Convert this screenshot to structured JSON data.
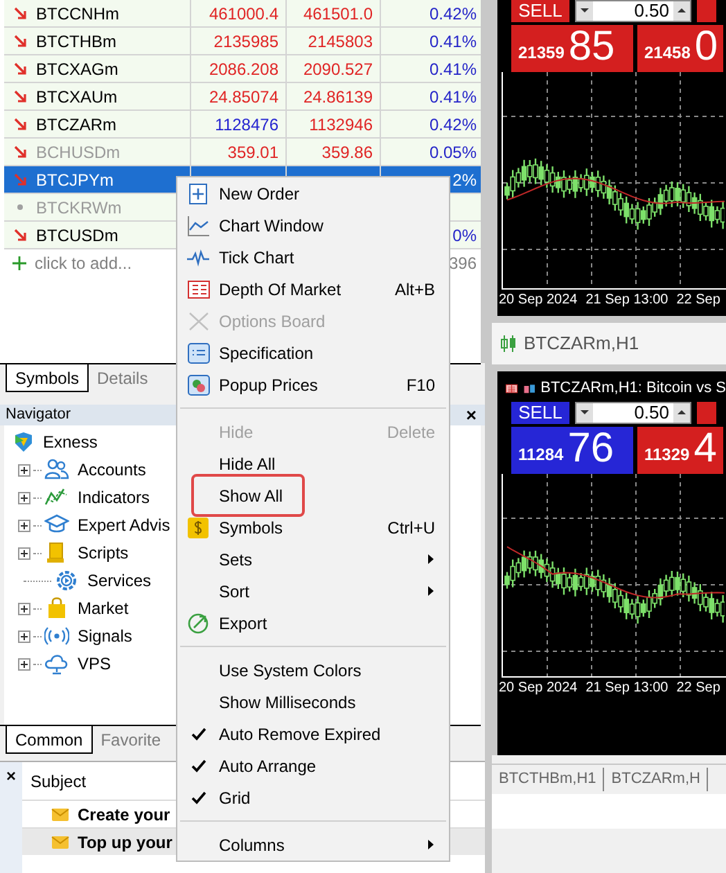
{
  "market_watch": {
    "rows": [
      {
        "symbol": "BTCCNHm",
        "kind": "down",
        "dimmed": false,
        "selected": false,
        "bid": "461000.4",
        "ask": "461501.0",
        "change": "0.42%",
        "bid_rising": false,
        "ask_rising": false
      },
      {
        "symbol": "BTCTHBm",
        "kind": "down",
        "dimmed": false,
        "selected": false,
        "bid": "2135985",
        "ask": "2145803",
        "change": "0.41%",
        "bid_rising": false,
        "ask_rising": false
      },
      {
        "symbol": "BTCXAGm",
        "kind": "down",
        "dimmed": false,
        "selected": false,
        "bid": "2086.208",
        "ask": "2090.527",
        "change": "0.41%",
        "bid_rising": false,
        "ask_rising": false
      },
      {
        "symbol": "BTCXAUm",
        "kind": "down",
        "dimmed": false,
        "selected": false,
        "bid": "24.85074",
        "ask": "24.86139",
        "change": "0.41%",
        "bid_rising": false,
        "ask_rising": false
      },
      {
        "symbol": "BTCZARm",
        "kind": "down",
        "dimmed": false,
        "selected": false,
        "bid": "1128476",
        "ask": "1132946",
        "change": "0.42%",
        "bid_rising": true,
        "ask_rising": false
      },
      {
        "symbol": "BCHUSDm",
        "kind": "down",
        "dimmed": true,
        "selected": false,
        "bid": "359.01",
        "ask": "359.86",
        "change": "0.05%",
        "bid_rising": false,
        "ask_rising": false
      },
      {
        "symbol": "BTCJPYm",
        "kind": "down",
        "dimmed": false,
        "selected": true,
        "change": "2%"
      },
      {
        "symbol": "BTCKRWm",
        "kind": "dot",
        "dimmed": true,
        "selected": false
      },
      {
        "symbol": "BTCUSDm",
        "kind": "down",
        "dimmed": false,
        "selected": false,
        "change": "0%"
      }
    ],
    "add_row": {
      "label": "click to add...",
      "value": "396"
    },
    "tabs": [
      {
        "label": "Symbols",
        "selected": true
      },
      {
        "label": "Details",
        "selected": false
      }
    ]
  },
  "navigator": {
    "title": "Navigator",
    "close": "×",
    "root": "Exness",
    "children": [
      {
        "label": "Accounts",
        "expanded": false
      },
      {
        "label": "Indicators",
        "expanded": false
      },
      {
        "label": "Expert Advis",
        "expanded": false
      },
      {
        "label": "Scripts",
        "expanded": false
      },
      {
        "label": "Services"
      },
      {
        "label": "Market",
        "expanded": false
      },
      {
        "label": "Signals",
        "expanded": false
      },
      {
        "label": "VPS",
        "expanded": false
      }
    ],
    "tabs": [
      {
        "label": "Common",
        "selected": true
      },
      {
        "label": "Favorite",
        "selected": false
      }
    ]
  },
  "toolbox": {
    "close": "×",
    "column": "Subject",
    "rows": [
      {
        "subject": "Create your",
        "selected": false
      },
      {
        "subject": "Top up your",
        "selected": true
      }
    ]
  },
  "charts": [
    {
      "sell": "SELL",
      "lot": "0.50",
      "bid_small": "21359",
      "bid_big": "85",
      "ask_small": "21458",
      "ask_big": "0",
      "bid_rising": false,
      "ask_rising": false,
      "xlabels": [
        "20 Sep 2024",
        "21 Sep 13:00",
        "22 Sep"
      ]
    },
    {
      "tab_label": "BTCZARm,H1",
      "title": "BTCZARm,H1: Bitcoin vs S",
      "sell": "SELL",
      "lot": "0.50",
      "bid_small": "11284",
      "bid_big": "76",
      "ask_small": "11329",
      "ask_big": "4",
      "bid_rising": true,
      "ask_rising": false,
      "xlabels": [
        "20 Sep 2024",
        "21 Sep 13:00",
        "22 Sep"
      ]
    }
  ],
  "chart_tabs": [
    {
      "label": "BTCTHBm,H1",
      "selected": false
    },
    {
      "label": "BTCZARm,H",
      "selected": false
    }
  ],
  "context_menu": [
    {
      "kind": "item",
      "label": "New Order"
    },
    {
      "kind": "item",
      "label": "Chart Window"
    },
    {
      "kind": "item",
      "label": "Tick Chart"
    },
    {
      "kind": "item",
      "label": "Depth Of Market",
      "shortcut": "Alt+B"
    },
    {
      "kind": "item",
      "label": "Options Board",
      "disabled": true
    },
    {
      "kind": "item",
      "label": "Specification"
    },
    {
      "kind": "item",
      "label": "Popup Prices",
      "shortcut": "F10"
    },
    {
      "kind": "separator"
    },
    {
      "kind": "item",
      "label": "Hide",
      "shortcut": "Delete",
      "disabled": true
    },
    {
      "kind": "item",
      "label": "Hide All"
    },
    {
      "kind": "item",
      "label": "Show All",
      "annotated": true
    },
    {
      "kind": "item",
      "label": "Symbols",
      "shortcut": "Ctrl+U"
    },
    {
      "kind": "item",
      "label": "Sets",
      "submenu": true
    },
    {
      "kind": "item",
      "label": "Sort",
      "submenu": true
    },
    {
      "kind": "item",
      "label": "Export"
    },
    {
      "kind": "separator"
    },
    {
      "kind": "item",
      "label": "Use System Colors",
      "checked": false
    },
    {
      "kind": "item",
      "label": "Show Milliseconds",
      "checked": false
    },
    {
      "kind": "item",
      "label": "Auto Remove Expired",
      "checked": true
    },
    {
      "kind": "item",
      "label": "Auto Arrange",
      "checked": true
    },
    {
      "kind": "item",
      "label": "Grid",
      "checked": true
    },
    {
      "kind": "separator"
    },
    {
      "kind": "item",
      "label": "Columns",
      "submenu": true
    }
  ]
}
